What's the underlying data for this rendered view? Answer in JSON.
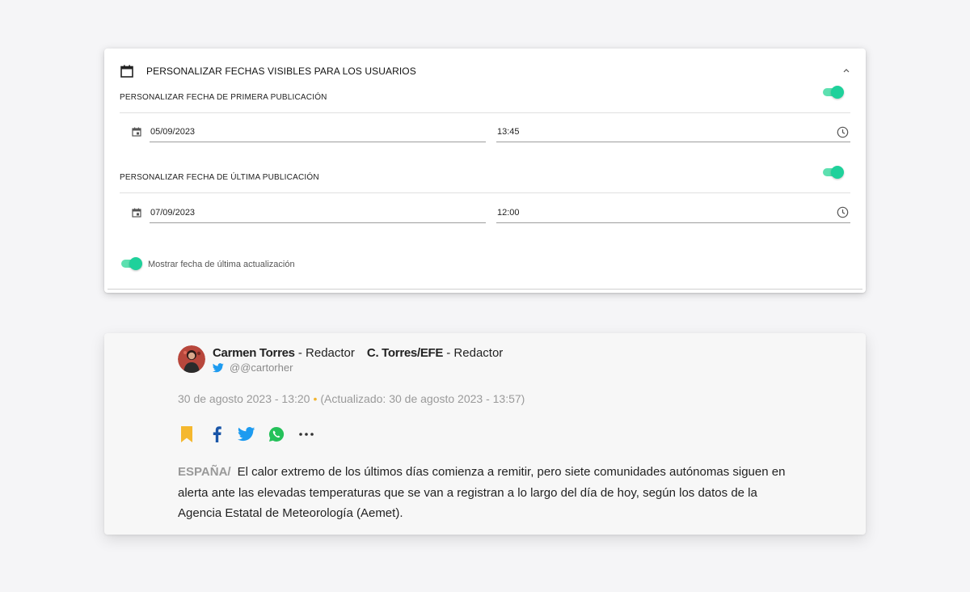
{
  "settings_panel": {
    "title": "PERSONALIZAR FECHAS VISIBLES PARA LOS USUARIOS",
    "first_publication": {
      "label": "PERSONALIZAR FECHA DE PRIMERA PUBLICACIÓN",
      "enabled": true,
      "date": "05/09/2023",
      "time": "13:45"
    },
    "last_publication": {
      "label": "PERSONALIZAR FECHA DE ÚLTIMA PUBLICACIÓN",
      "enabled": true,
      "date": "07/09/2023",
      "time": "12:00"
    },
    "show_last_update": {
      "label": "Mostrar fecha de última actualización",
      "enabled": true
    },
    "accent_color": "#1fd19b"
  },
  "article": {
    "author1_name": "Carmen Torres",
    "author1_role": " - Redactor",
    "author2_name": "C. Torres/EFE",
    "author2_role": " - Redactor",
    "twitter_handle": "@@cartorher",
    "published": "30 de agosto 2023 - 13:20",
    "separator": "•",
    "updated": "(Actualizado: 30 de agosto 2023 - 13:57)",
    "share_icons": [
      "bookmark-icon",
      "facebook-icon",
      "twitter-icon",
      "whatsapp-icon",
      "more-icon"
    ],
    "location": "ESPAÑA/",
    "body": "El calor extremo de los últimos días comienza a remitir, pero siete comunidades autónomas siguen en alerta ante las elevadas temperaturas que se van a registran a lo largo del día de hoy, según los datos de la Agencia Estatal de Meteorología (Aemet).",
    "colors": {
      "bookmark": "#f5b82e",
      "facebook": "#1a56a8",
      "twitter": "#1d9bf0",
      "whatsapp": "#25c15a"
    }
  }
}
